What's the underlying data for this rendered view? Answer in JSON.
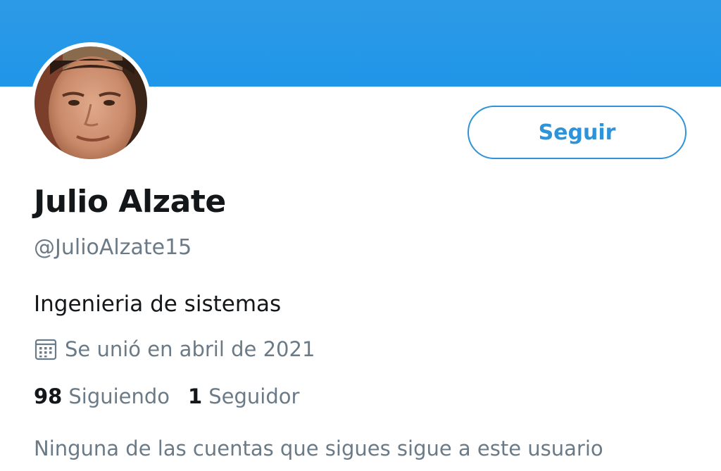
{
  "profile": {
    "display_name": "Julio Alzate",
    "handle": "@JulioAlzate15",
    "bio": "Ingenieria de sistemas",
    "joined": "Se unió en abril de 2021",
    "avatar_icon": "profile-photo"
  },
  "actions": {
    "follow_label": "Seguir"
  },
  "stats": {
    "following_count": "98",
    "following_label": "Siguiendo",
    "followers_count": "1",
    "followers_label": "Seguidor"
  },
  "mutual_followers_text": "Ninguna de las cuentas que sigues sigue a este usuario",
  "colors": {
    "banner": "#1f96e8",
    "accent": "#2e93d8",
    "text_primary": "#14171a",
    "text_secondary": "#6b7a87"
  }
}
